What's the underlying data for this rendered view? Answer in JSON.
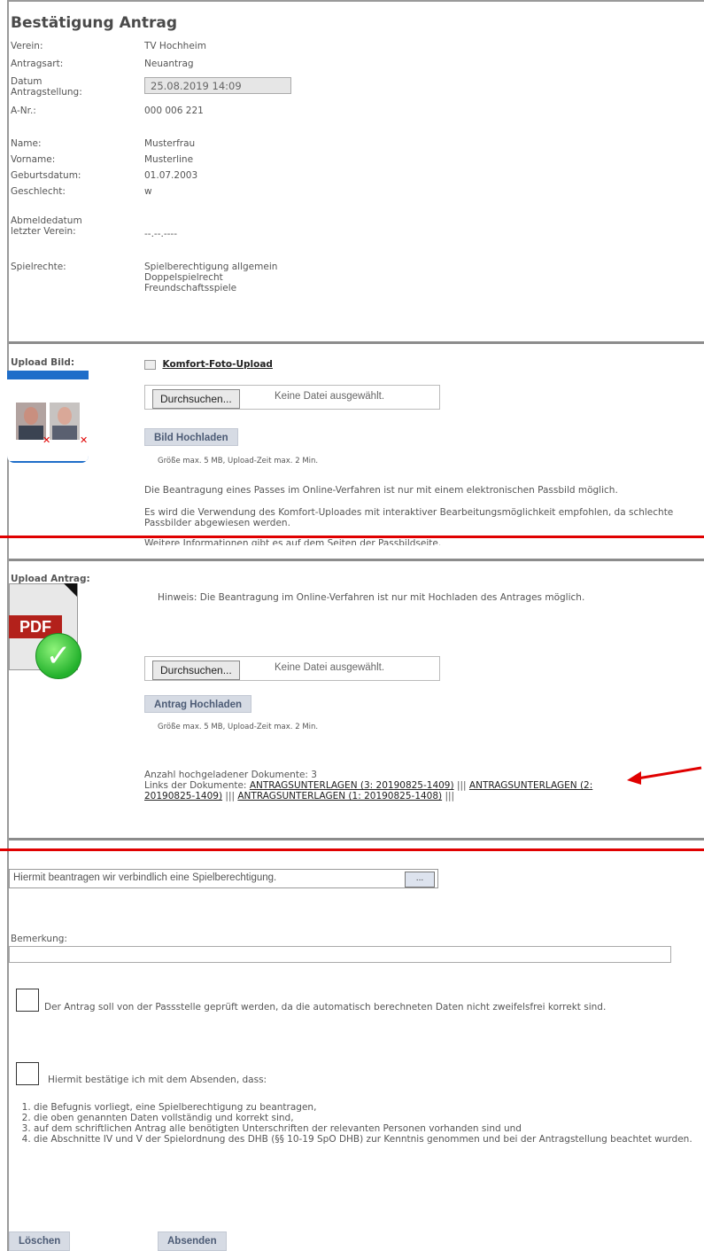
{
  "page": {
    "title": "Bestätigung Antrag",
    "fields": [
      {
        "label": "Verein:",
        "value": "TV Hochheim"
      },
      {
        "label": "Antragsart:",
        "value": "Neuantrag"
      },
      {
        "label": "Datum Antragstellung:",
        "value": "25.08.2019 14:09"
      },
      {
        "label": "A-Nr.:",
        "value": "000 006 221"
      },
      {
        "label": "Name:",
        "value": "Musterfrau"
      },
      {
        "label": "Vorname:",
        "value": "Musterline"
      },
      {
        "label": "Geburtsdatum:",
        "value": "01.07.2003"
      },
      {
        "label": "Geschlecht:",
        "value": "w"
      },
      {
        "label": "Abmeldedatum letzter Verein:",
        "value": "--.--.----"
      },
      {
        "label": "Spielrechte:",
        "value": "Spielberechtigung allgemein\nDoppelspielrecht\nFreundschaftsspiele"
      }
    ]
  },
  "upload_bild": {
    "label": "Upload Bild:",
    "komfort_link": "Komfort-Foto-Upload",
    "file_button": "Durchsuchen...",
    "no_file": "Keine Datei ausgewählt.",
    "upload_button": "Bild Hochladen",
    "size_hint": "Größe max. 5 MB, Upload-Zeit max. 2 Min.",
    "info_1": "Die Beantragung eines Passes im Online-Verfahren ist nur mit einem elektronischen Passbild möglich.",
    "info_2": "Es wird die Verwendung des Komfort-Uploades mit interaktiver Bearbeitungsmöglichkeit empfohlen, da schlechte Passbilder abgewiesen werden.",
    "info_3": "Weitere Informationen gibt es auf dem Seiten der Passbildseite."
  },
  "upload_antrag": {
    "label": "Upload Antrag:",
    "pdf_text": "PDF",
    "hint": "Hinweis: Die Beantragung im Online-Verfahren ist nur mit Hochladen des Antrages möglich.",
    "file_button": "Durchsuchen...",
    "no_file": "Keine Datei ausgewählt.",
    "upload_button": "Antrag Hochladen",
    "size_hint": "Größe max. 5 MB, Upload-Zeit max. 2 Min.",
    "count_text": "Anzahl hochgeladener Dokumente: 3",
    "links_prefix": "Links der Dokumente:",
    "links": [
      "ANTRAGSUNTERLAGEN (3: 20190825-1409)",
      "ANTRAGSUNTERLAGEN (2: 20190825-1409)",
      "ANTRAGSUNTERLAGEN (1: 20190825-1408)"
    ],
    "separator": "|||"
  },
  "confirm": {
    "select_text": "Hiermit beantragen wir verbindlich eine Spielberechtigung.",
    "select_button": "...",
    "bemerkung_label": "Bemerkung:",
    "check1_text": "Der Antrag soll von der Passstelle geprüft werden, da die automatisch berechneten Daten nicht zweifelsfrei korrekt sind.",
    "check2_text": "Hiermit bestätige ich mit dem Absenden, dass:",
    "list": [
      "die Befugnis vorliegt, eine Spielberechtigung zu beantragen,",
      "die oben genannten Daten vollständig und korrekt sind,",
      "auf dem schriftlichen Antrag alle benötigten Unterschriften der relevanten Personen vorhanden sind und",
      "die Abschnitte IV und V der Spielordnung des DHB (§§ 10-19 SpO DHB) zur Kenntnis genommen und bei der Antragstellung beachtet wurden."
    ],
    "delete_button": "Löschen",
    "submit_button": "Absenden"
  },
  "colors": {
    "annotation_red": "#e00000",
    "button_bg": "#d6dbe4",
    "button_text": "#4c5b75"
  }
}
